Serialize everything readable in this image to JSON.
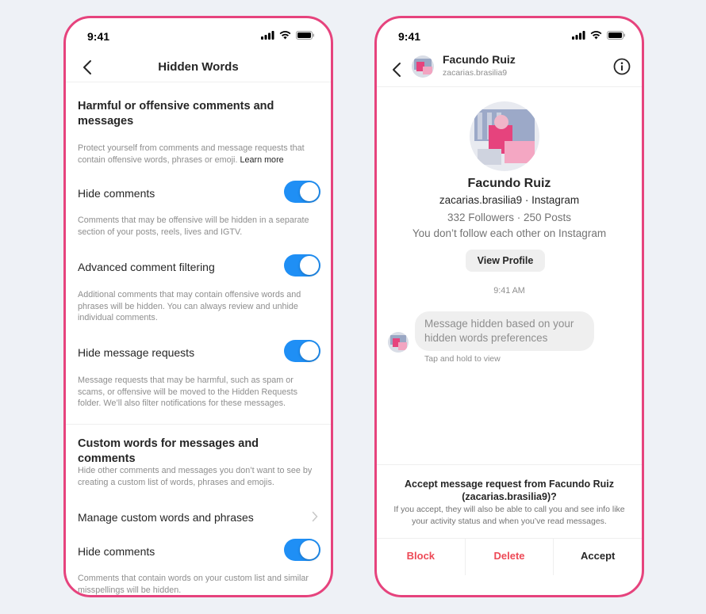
{
  "colors": {
    "accent_pink": "#e6437d",
    "toggle_blue": "#1f8ff5",
    "danger_red": "#ed4956"
  },
  "left": {
    "status_time": "9:41",
    "title": "Hidden Words",
    "section1": {
      "title": "Harmful or offensive comments and messages",
      "desc": "Protect yourself from comments and message requests that contain offensive words, phrases or emoji.",
      "link": "Learn more"
    },
    "rows": [
      {
        "label": "Hide comments",
        "on": true,
        "desc": "Comments that may be offensive will be hidden in a separate section of your posts, reels, lives and IGTV."
      },
      {
        "label": "Advanced comment filtering",
        "on": true,
        "desc": "Additional comments that may contain offensive words and phrases will be hidden. You can always review and unhide individual comments."
      },
      {
        "label": "Hide message requests",
        "on": true,
        "desc": "Message requests that may be harmful, such as spam or scams, or offensive will be moved to the Hidden Requests folder. We’ll also filter notifications for these messages."
      }
    ],
    "section2": {
      "title": "Custom words for messages and comments",
      "desc": "Hide other comments and messages you don’t want to see by creating a custom list of words, phrases and emojis."
    },
    "manage_label": "Manage custom words and phrases",
    "custom_hide": {
      "label": "Hide comments",
      "on": true,
      "desc": "Comments that contain words on your custom list and similar misspellings will be hidden."
    }
  },
  "right": {
    "status_time": "9:41",
    "header": {
      "name": "Facundo Ruiz",
      "handle": "zacarias.brasilia9"
    },
    "profile": {
      "name": "Facundo Ruiz",
      "handle_line": "zacarias.brasilia9 · Instagram",
      "stats": "332 Followers · 250 Posts",
      "follow_note": "You don’t follow each other on Instagram",
      "view_button": "View Profile"
    },
    "message": {
      "time": "9:41 AM",
      "bubble": "Message hidden based on your hidden words preferences",
      "hint": "Tap and hold to view"
    },
    "accept": {
      "title": "Accept message request from Facundo Ruiz (zacarias.brasilia9)?",
      "desc": "If you accept, they will also be able to call you and see info like your activity status and when you’ve read messages.",
      "block": "Block",
      "delete": "Delete",
      "accept": "Accept"
    }
  }
}
